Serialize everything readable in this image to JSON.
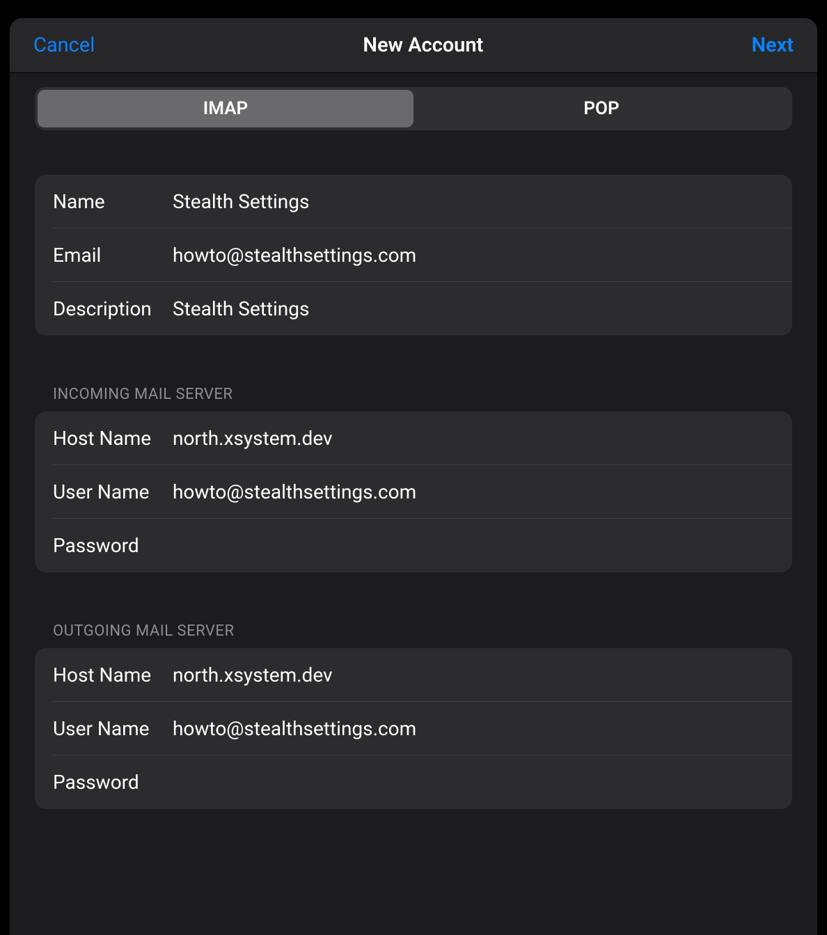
{
  "header": {
    "cancel": "Cancel",
    "title": "New Account",
    "next": "Next"
  },
  "segments": {
    "imap": "IMAP",
    "pop": "POP"
  },
  "account": {
    "name_label": "Name",
    "name_value": "Stealth Settings",
    "email_label": "Email",
    "email_value": "howto@stealthsettings.com",
    "description_label": "Description",
    "description_value": "Stealth Settings"
  },
  "incoming": {
    "section": "INCOMING MAIL SERVER",
    "host_label": "Host Name",
    "host_value": "north.xsystem.dev",
    "user_label": "User Name",
    "user_value": "howto@stealthsettings.com",
    "password_label": "Password",
    "password_value": ""
  },
  "outgoing": {
    "section": "OUTGOING MAIL SERVER",
    "host_label": "Host Name",
    "host_value": "north.xsystem.dev",
    "user_label": "User Name",
    "user_value": "howto@stealthsettings.com",
    "password_label": "Password",
    "password_value": ""
  }
}
